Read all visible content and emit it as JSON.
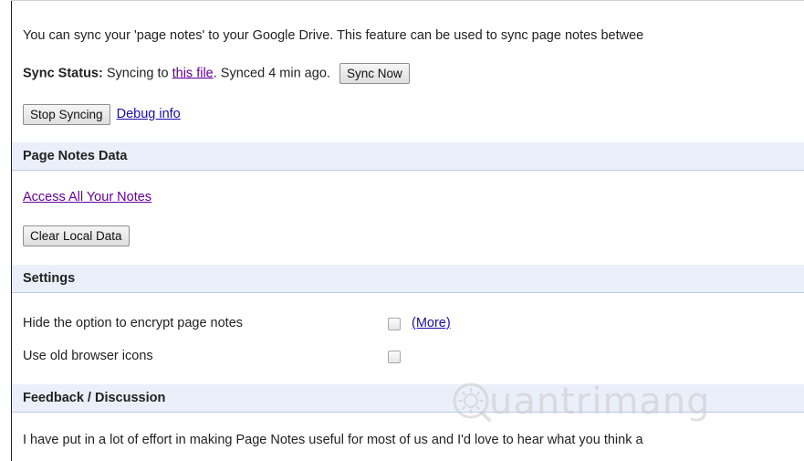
{
  "intro": {
    "text": "You can sync your 'page notes' to your Google Drive. This feature can be used to sync page notes betwee"
  },
  "sync_status": {
    "label": "Sync Status:",
    "prefix": " Syncing to ",
    "link_text": "this file",
    "suffix": ". Synced 4 min ago.",
    "sync_now_label": "Sync Now"
  },
  "sync_actions": {
    "stop_label": "Stop Syncing",
    "debug_link": "Debug info"
  },
  "sections": {
    "page_notes_data": {
      "title": "Page Notes Data",
      "access_link": "Access All Your Notes",
      "clear_label": "Clear Local Data"
    },
    "settings": {
      "title": "Settings",
      "options": [
        {
          "label": "Hide the option to encrypt page notes",
          "checked": false,
          "more_link": "(More)"
        },
        {
          "label": "Use old browser icons",
          "checked": false
        }
      ]
    },
    "feedback": {
      "title": "Feedback / Discussion",
      "text": "I have put in a lot of effort in making Page Notes useful for most of us and I'd love to hear what you think a"
    }
  },
  "watermark": {
    "text": "uantrimang"
  },
  "colors": {
    "header_bg": "#ebeff9",
    "header_border": "#b9cbe9",
    "link": "#1a0dab",
    "visited_link": "#660099"
  }
}
